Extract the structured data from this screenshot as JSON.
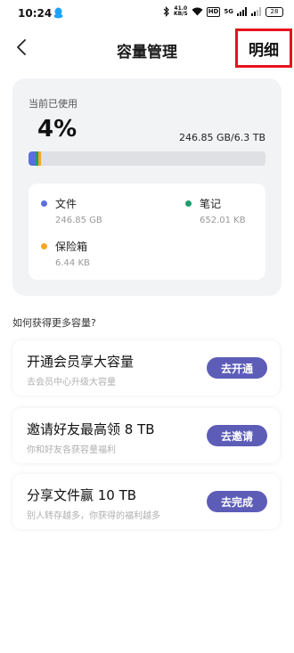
{
  "status_bar": {
    "time": "10:24",
    "speed_value": "41.0",
    "speed_unit": "KB/S",
    "hd_tag": "HD",
    "signal_tag": "5G",
    "battery": "28"
  },
  "header": {
    "title": "容量管理",
    "detail_label": "明细"
  },
  "usage": {
    "label": "当前已使用",
    "percent": "4%",
    "amount": "246.85 GB/6.3 TB",
    "used_fraction": 0.04,
    "colors": {
      "files": "#5b6ee1",
      "notes": "#1f9d6e",
      "vault": "#f5a623"
    },
    "legend": [
      {
        "name": "文件",
        "size": "246.85 GB"
      },
      {
        "name": "笔记",
        "size": "652.01 KB"
      },
      {
        "name": "保险箱",
        "size": "6.44 KB"
      }
    ]
  },
  "section_title": "如何获得更多容量?",
  "promos": [
    {
      "title": "开通会员享大容量",
      "subtitle": "去会员中心升级大容量",
      "button": "去开通"
    },
    {
      "title": "邀请好友最高领 8 TB",
      "subtitle": "你和好友各获容量福利",
      "button": "去邀请"
    },
    {
      "title": "分享文件赢 10 TB",
      "subtitle": "别人转存越多，你获得的福利越多",
      "button": "去完成"
    }
  ],
  "accent_color": "#5d5db8",
  "highlight_color": "#e8121c"
}
